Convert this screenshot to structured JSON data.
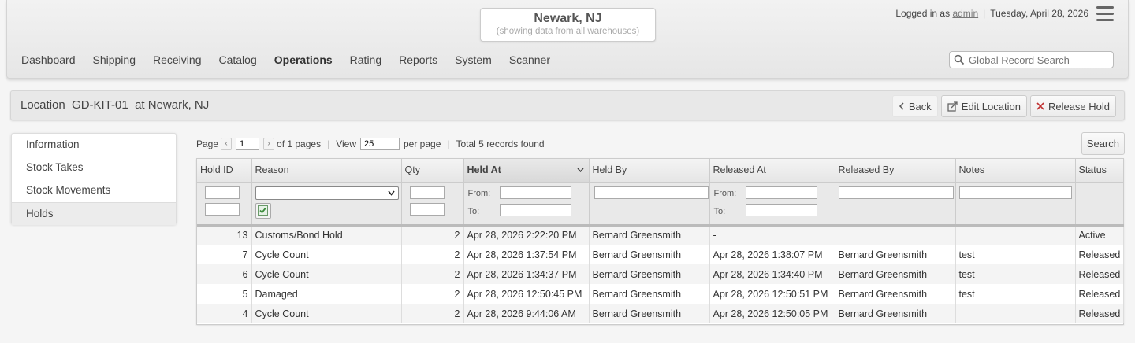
{
  "header": {
    "location": "Newark, NJ",
    "location_sub": "(showing data from all warehouses)",
    "logged_in_prefix": "Logged in as",
    "user": "admin",
    "date": "Tuesday, April 28, 2026",
    "search_placeholder": "Global Record Search"
  },
  "nav": [
    "Dashboard",
    "Shipping",
    "Receiving",
    "Catalog",
    "Operations",
    "Rating",
    "Reports",
    "System",
    "Scanner"
  ],
  "page": {
    "title": "Location  GD-KIT-01  at Newark, NJ",
    "back": "Back",
    "edit": "Edit Location",
    "release": "Release Hold"
  },
  "sidemenu": [
    "Information",
    "Stock Takes",
    "Stock Movements",
    "Holds"
  ],
  "pager": {
    "page_label": "Page",
    "page": "1",
    "of_pages": "of 1 pages",
    "view_label": "View",
    "per_page_value": "25",
    "per_page": "per page",
    "total": "Total 5 records found",
    "search": "Search"
  },
  "grid": {
    "columns": [
      "Hold ID",
      "Reason",
      "Qty",
      "Held At",
      "Held By",
      "Released At",
      "Released By",
      "Notes",
      "Status"
    ],
    "from_label": "From:",
    "to_label": "To:",
    "rows": [
      [
        "13",
        "Customs/Bond Hold",
        "2",
        "Apr 28, 2026 2:22:20 PM",
        "Bernard Greensmith",
        "-",
        "",
        "",
        "Active"
      ],
      [
        "7",
        "Cycle Count",
        "2",
        "Apr 28, 2026 1:37:54 PM",
        "Bernard Greensmith",
        "Apr 28, 2026 1:38:07 PM",
        "Bernard Greensmith",
        "test",
        "Released"
      ],
      [
        "6",
        "Cycle Count",
        "2",
        "Apr 28, 2026 1:34:37 PM",
        "Bernard Greensmith",
        "Apr 28, 2026 1:34:40 PM",
        "Bernard Greensmith",
        "test",
        "Released"
      ],
      [
        "5",
        "Damaged",
        "2",
        "Apr 28, 2026 12:50:45 PM",
        "Bernard Greensmith",
        "Apr 28, 2026 12:50:51 PM",
        "Bernard Greensmith",
        "test",
        "Released"
      ],
      [
        "4",
        "Cycle Count",
        "2",
        "Apr 28, 2026 9:44:06 AM",
        "Bernard Greensmith",
        "Apr 28, 2026 12:50:05 PM",
        "Bernard Greensmith",
        "",
        "Released"
      ]
    ]
  }
}
